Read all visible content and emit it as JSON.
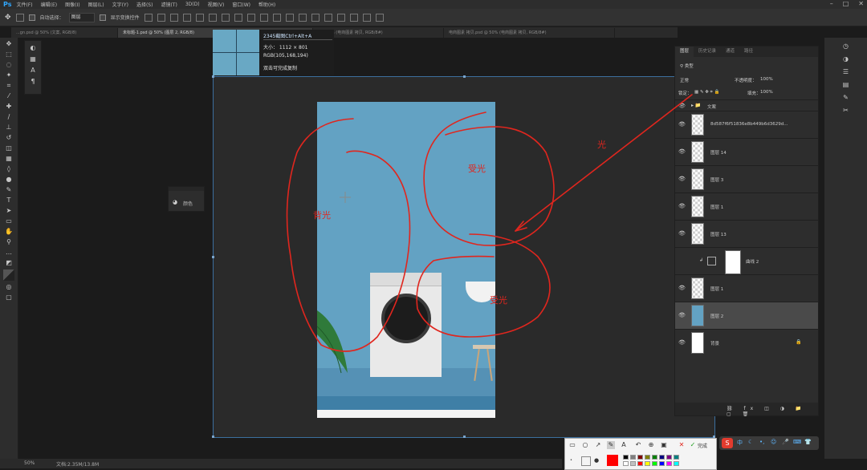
{
  "app": {
    "logo": "Ps",
    "menu": [
      "文件(F)",
      "编辑(E)",
      "图像(I)",
      "图层(L)",
      "文字(Y)",
      "选择(S)",
      "滤镜(T)",
      "3D(D)",
      "视图(V)",
      "窗口(W)",
      "帮助(H)"
    ]
  },
  "options": {
    "auto_select": "自动选择：",
    "auto_select_value": "图层",
    "show_transform": "显示变换控件"
  },
  "tabs": [
    {
      "label": "...gn.psd @ 50% (文案, RGB/8)",
      "active": false
    },
    {
      "label": "未标题-1.psd @ 50% (图层 2, RGB/8)",
      "active": true
    },
    {
      "label": "...41.4% (电商图素 拷贝, RGB/8#)",
      "active": false
    },
    {
      "label": "电商图素 拷贝.psd @ 50% (电商图素 拷贝, RGB/8#)",
      "active": false
    }
  ],
  "tooltip": {
    "title": "2345截图Ctrl+Alt+A",
    "size": "大小：  1112 × 801",
    "rgb": "RGB(105,168,194)",
    "hint": "双击可完成复制"
  },
  "annotations": {
    "back_light": "背光",
    "light_1": "受光",
    "light_2": "受光",
    "light_3": "光"
  },
  "doc_panel": {
    "label": "颜色"
  },
  "layers_panel": {
    "tabs": [
      "图层",
      "历史记录",
      "通道",
      "路径"
    ],
    "kind": "类型",
    "blend_mode": "正常",
    "opacity_label": "不透明度：",
    "opacity": "100%",
    "lock_label": "锁定：",
    "fill_label": "填充：",
    "fill": "100%",
    "layers": [
      {
        "name": "文案"
      },
      {
        "name": "8d587f6f51836e8b449b6d3629d..."
      },
      {
        "name": "图层 14"
      },
      {
        "name": "图层 3"
      },
      {
        "name": "图层 1"
      },
      {
        "name": "图层 13"
      },
      {
        "name": "曲线 2"
      },
      {
        "name": "图层 1"
      },
      {
        "name": "图层 2"
      },
      {
        "name": "背景"
      }
    ]
  },
  "status": {
    "zoom": "50%",
    "doc": "文档:2.35M/13.8M"
  },
  "snap_toolbar": {
    "done_label": "完成"
  },
  "colors": {
    "canvas_blue": "#69a8c4",
    "annotation_red": "#e0261e",
    "ps_blue": "#31a8ff"
  }
}
